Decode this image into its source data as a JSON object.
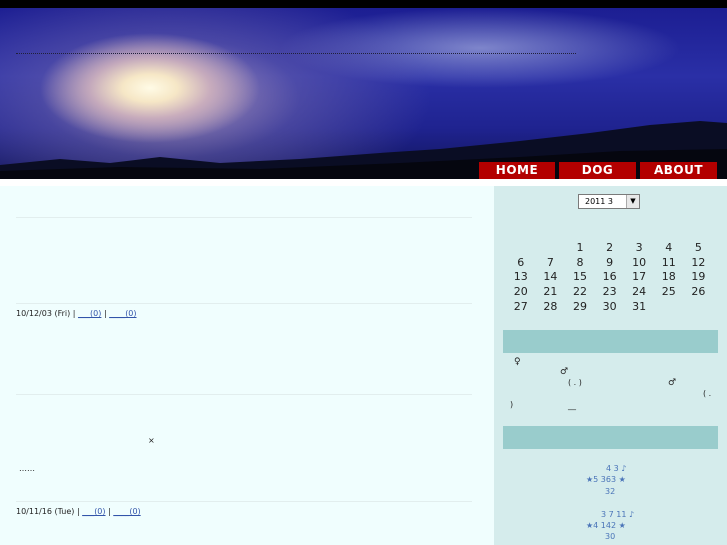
{
  "nav": {
    "home": "HOME",
    "dog": "DOG",
    "about": "ABOUT"
  },
  "entries": [
    {
      "date": "10/12/03 (Fri)",
      "sep1": "|",
      "link1": "___(0)",
      "sep2": "|",
      "link2": "____(0)"
    },
    {
      "date": "10/11/16 (Tue)",
      "sep1": "|",
      "link1": "___(0)",
      "sep2": "|",
      "link2": "____(0)"
    }
  ],
  "body_marks": {
    "cross": "×",
    "ellipsis": "……"
  },
  "calendar": {
    "selected": "2011 3",
    "rows": [
      [
        "",
        "",
        "1",
        "2",
        "3",
        "4",
        "5"
      ],
      [
        "6",
        "7",
        "8",
        "9",
        "10",
        "11",
        "12"
      ],
      [
        "13",
        "14",
        "15",
        "16",
        "17",
        "18",
        "19"
      ],
      [
        "20",
        "21",
        "22",
        "23",
        "24",
        "25",
        "26"
      ],
      [
        "27",
        "28",
        "29",
        "30",
        "31",
        "",
        ""
      ]
    ]
  },
  "profile": {
    "female": "♀",
    "male1": "♂",
    "paren1": "( .  )",
    "male2": "♂",
    "paren2": "( .",
    "close": ")",
    "underscore": "__"
  },
  "recent": [
    {
      "line1": "4   3 ♪",
      "line2": "★5      363 ★",
      "line3": "32"
    },
    {
      "line1": "3 7   11 ♪",
      "line2": "★4      142 ★",
      "line3": "30"
    }
  ]
}
